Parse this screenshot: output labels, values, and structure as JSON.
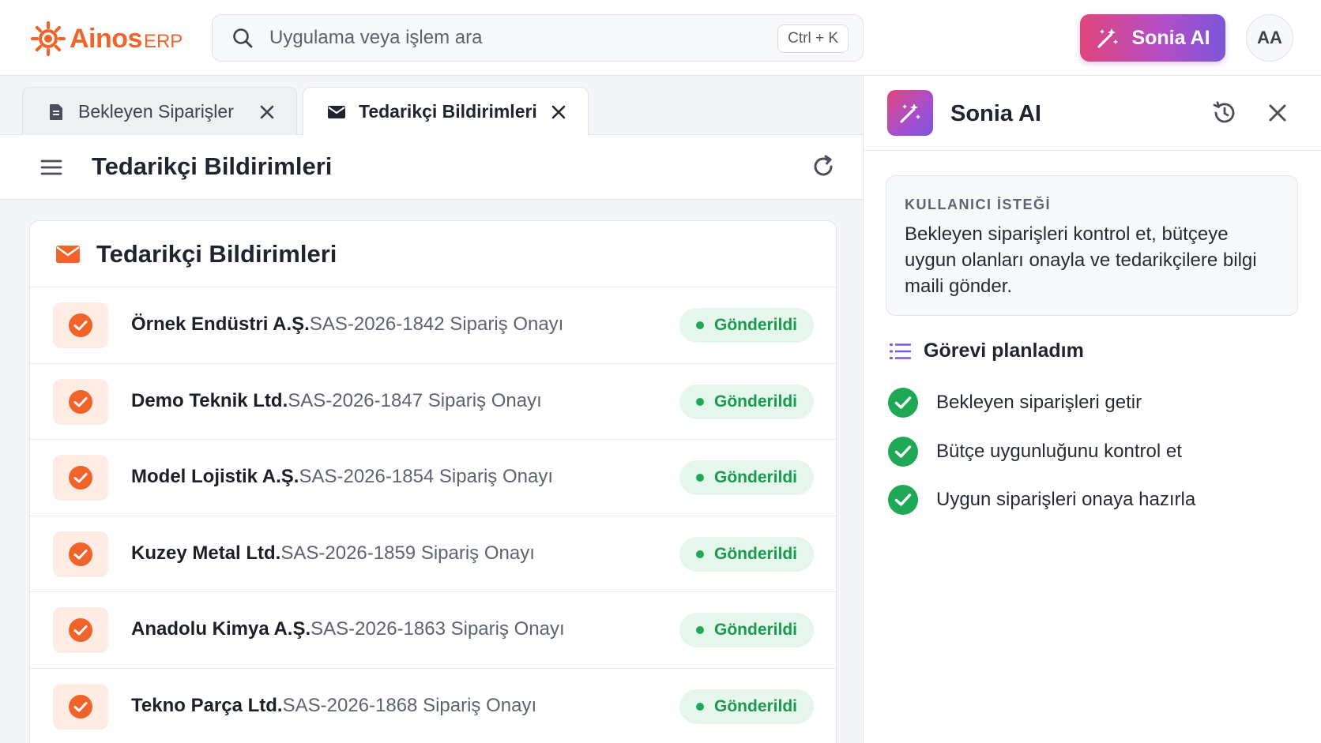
{
  "app": {
    "logo_text": "Ainos",
    "logo_sub": "ERP"
  },
  "search": {
    "placeholder": "Uygulama veya işlem ara",
    "shortcut": "Ctrl + K"
  },
  "ai_button": {
    "label": "Sonia AI"
  },
  "user": {
    "initials": "AA"
  },
  "tabs": [
    {
      "label": "Bekleyen Siparişler",
      "icon": "document-icon",
      "active": false
    },
    {
      "label": "Tedarikçi Bildirimleri",
      "icon": "mail-icon",
      "active": true
    }
  ],
  "page": {
    "title": "Tedarikçi Bildirimleri"
  },
  "card": {
    "title": "Tedarikçi Bildirimleri",
    "rows": [
      {
        "company": "Örnek Endüstri A.Ş.",
        "ref": "SAS-2026-1842 Sipariş Onayı",
        "status": "Gönderildi"
      },
      {
        "company": "Demo Teknik Ltd.",
        "ref": "SAS-2026-1847 Sipariş Onayı",
        "status": "Gönderildi"
      },
      {
        "company": "Model Lojistik A.Ş.",
        "ref": "SAS-2026-1854 Sipariş Onayı",
        "status": "Gönderildi"
      },
      {
        "company": "Kuzey Metal Ltd.",
        "ref": "SAS-2026-1859 Sipariş Onayı",
        "status": "Gönderildi"
      },
      {
        "company": "Anadolu Kimya A.Ş.",
        "ref": "SAS-2026-1863 Sipariş Onayı",
        "status": "Gönderildi"
      },
      {
        "company": "Tekno Parça Ltd.",
        "ref": "SAS-2026-1868 Sipariş Onayı",
        "status": "Gönderildi"
      }
    ]
  },
  "panel": {
    "title": "Sonia AI",
    "request_label": "KULLANICI İSTEĞİ",
    "request_text": "Bekleyen siparişleri kontrol et, bütçeye uygun olanları onayla ve tedarikçilere bilgi maili gönder.",
    "plan_title": "Görevi planladım",
    "steps": [
      "Bekleyen siparişleri getir",
      "Bütçe uygunluğunu kontrol et",
      "Uygun siparişleri onaya hazırla"
    ]
  },
  "colors": {
    "brand": "#f0642a",
    "success": "#1fa855",
    "ai_gradient_start": "#e0457b",
    "ai_gradient_end": "#7b56d8"
  }
}
